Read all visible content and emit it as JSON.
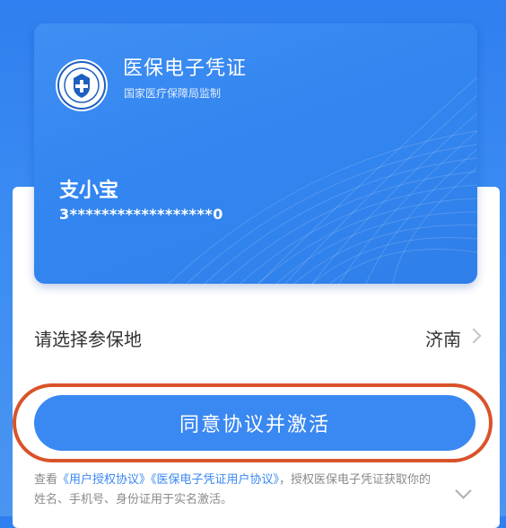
{
  "card": {
    "title": "医保电子凭证",
    "subtitle": "国家医疗保障局监制",
    "holder_name": "支小宝",
    "id_number": "3******************0",
    "emblem_icon": "national-healthcare-security-emblem-icon"
  },
  "region": {
    "label": "请选择参保地",
    "value": "济南",
    "chevron_icon": "chevron-right-icon"
  },
  "activate": {
    "label": "同意协议并激活"
  },
  "agreement": {
    "prefix": "查看",
    "link1": "《用户授权协议》",
    "link2": "《医保电子凭证用户协议》",
    "suffix": "，授权医保电子凭证获取你的姓名、手机号、身份证用于实名激活。",
    "expand_icon": "chevron-down-icon"
  },
  "colors": {
    "primary": "#3a88f2",
    "highlight": "#d9532a",
    "background": "#2f7ff0"
  }
}
